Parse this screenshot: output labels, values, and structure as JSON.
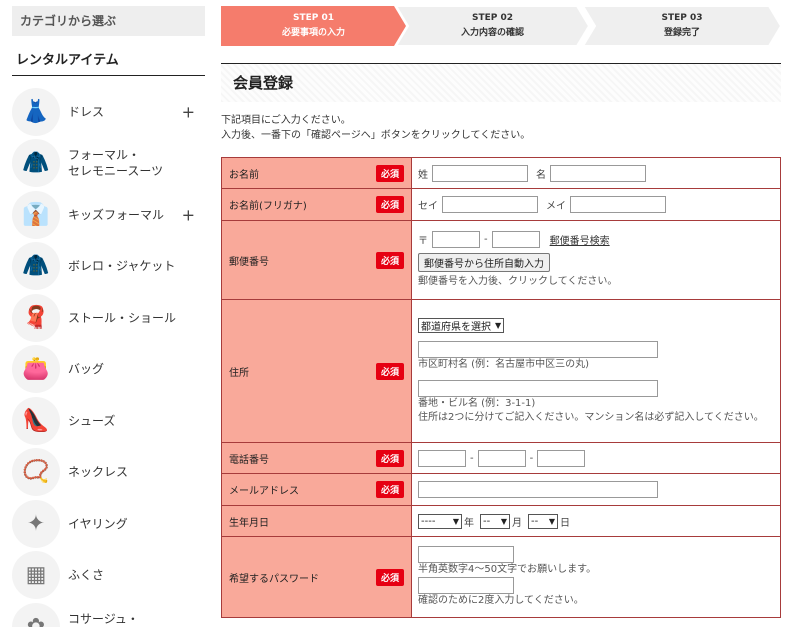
{
  "sidebar": {
    "category_header": "カテゴリから選ぶ",
    "rental_header": "レンタルアイテム",
    "items": [
      {
        "label": "ドレス",
        "icon": "dress-icon",
        "has_plus": true
      },
      {
        "label": "フォーマル・\nセレモニースーツ",
        "icon": "suit-icon",
        "has_plus": false
      },
      {
        "label": "キッズフォーマル",
        "icon": "kids-formal-icon",
        "has_plus": true
      },
      {
        "label": "ボレロ・ジャケット",
        "icon": "bolero-icon",
        "has_plus": false
      },
      {
        "label": "ストール・ショール",
        "icon": "stole-icon",
        "has_plus": false
      },
      {
        "label": "バッグ",
        "icon": "bag-icon",
        "has_plus": false
      },
      {
        "label": "シューズ",
        "icon": "shoes-icon",
        "has_plus": false
      },
      {
        "label": "ネックレス",
        "icon": "necklace-icon",
        "has_plus": false
      },
      {
        "label": "イヤリング",
        "icon": "earring-icon",
        "has_plus": false
      },
      {
        "label": "ふくさ",
        "icon": "fukusa-icon",
        "has_plus": false
      },
      {
        "label": "コサージュ・\nブローチ",
        "icon": "corsage-icon",
        "has_plus": false
      }
    ],
    "plus_symbol": "+"
  },
  "steps": [
    {
      "num": "STEP 01",
      "label": "必要事項の入力",
      "active": true
    },
    {
      "num": "STEP 02",
      "label": "入力内容の確認",
      "active": false
    },
    {
      "num": "STEP 03",
      "label": "登録完了",
      "active": false
    }
  ],
  "colors": {
    "step_active": "#f57c6c",
    "step_inactive": "#efefef",
    "label_bg": "#f9a99a",
    "required_badge": "#e60012",
    "table_border": "#a73b3b"
  },
  "title": "会員登録",
  "intro": {
    "line1": "下記項目にご入力ください。",
    "line2": "入力後、一番下の「確認ページへ」ボタンをクリックしてください。"
  },
  "form": {
    "required_label": "必須",
    "name": {
      "label": "お名前",
      "sei": "姓",
      "mei": "名"
    },
    "kana": {
      "label": "お名前(フリガナ)",
      "sei": "セイ",
      "mei": "メイ"
    },
    "zip": {
      "label": "郵便番号",
      "mark": "〒",
      "dash": "-",
      "search_link": "郵便番号検索",
      "auto_button": "郵便番号から住所自動入力",
      "note": "郵便番号を入力後、クリックしてください。"
    },
    "address": {
      "label": "住所",
      "pref_select": "都道府県を選択",
      "city_note": "市区町村名 (例：名古屋市中区三の丸)",
      "street_note": "番地・ビル名 (例：3-1-1)",
      "note": "住所は2つに分けてご記入ください。マンション名は必ず記入してください。"
    },
    "phone": {
      "label": "電話番号",
      "dash": "-"
    },
    "email": {
      "label": "メールアドレス"
    },
    "birthday": {
      "label": "生年月日",
      "year_value": "----",
      "month_value": "--",
      "day_value": "--",
      "year": "年",
      "month": "月",
      "day": "日"
    },
    "password": {
      "label": "希望するパスワード",
      "note1": "半角英数字4～50文字でお願いします。",
      "note2": "確認のために2度入力してください。"
    }
  }
}
